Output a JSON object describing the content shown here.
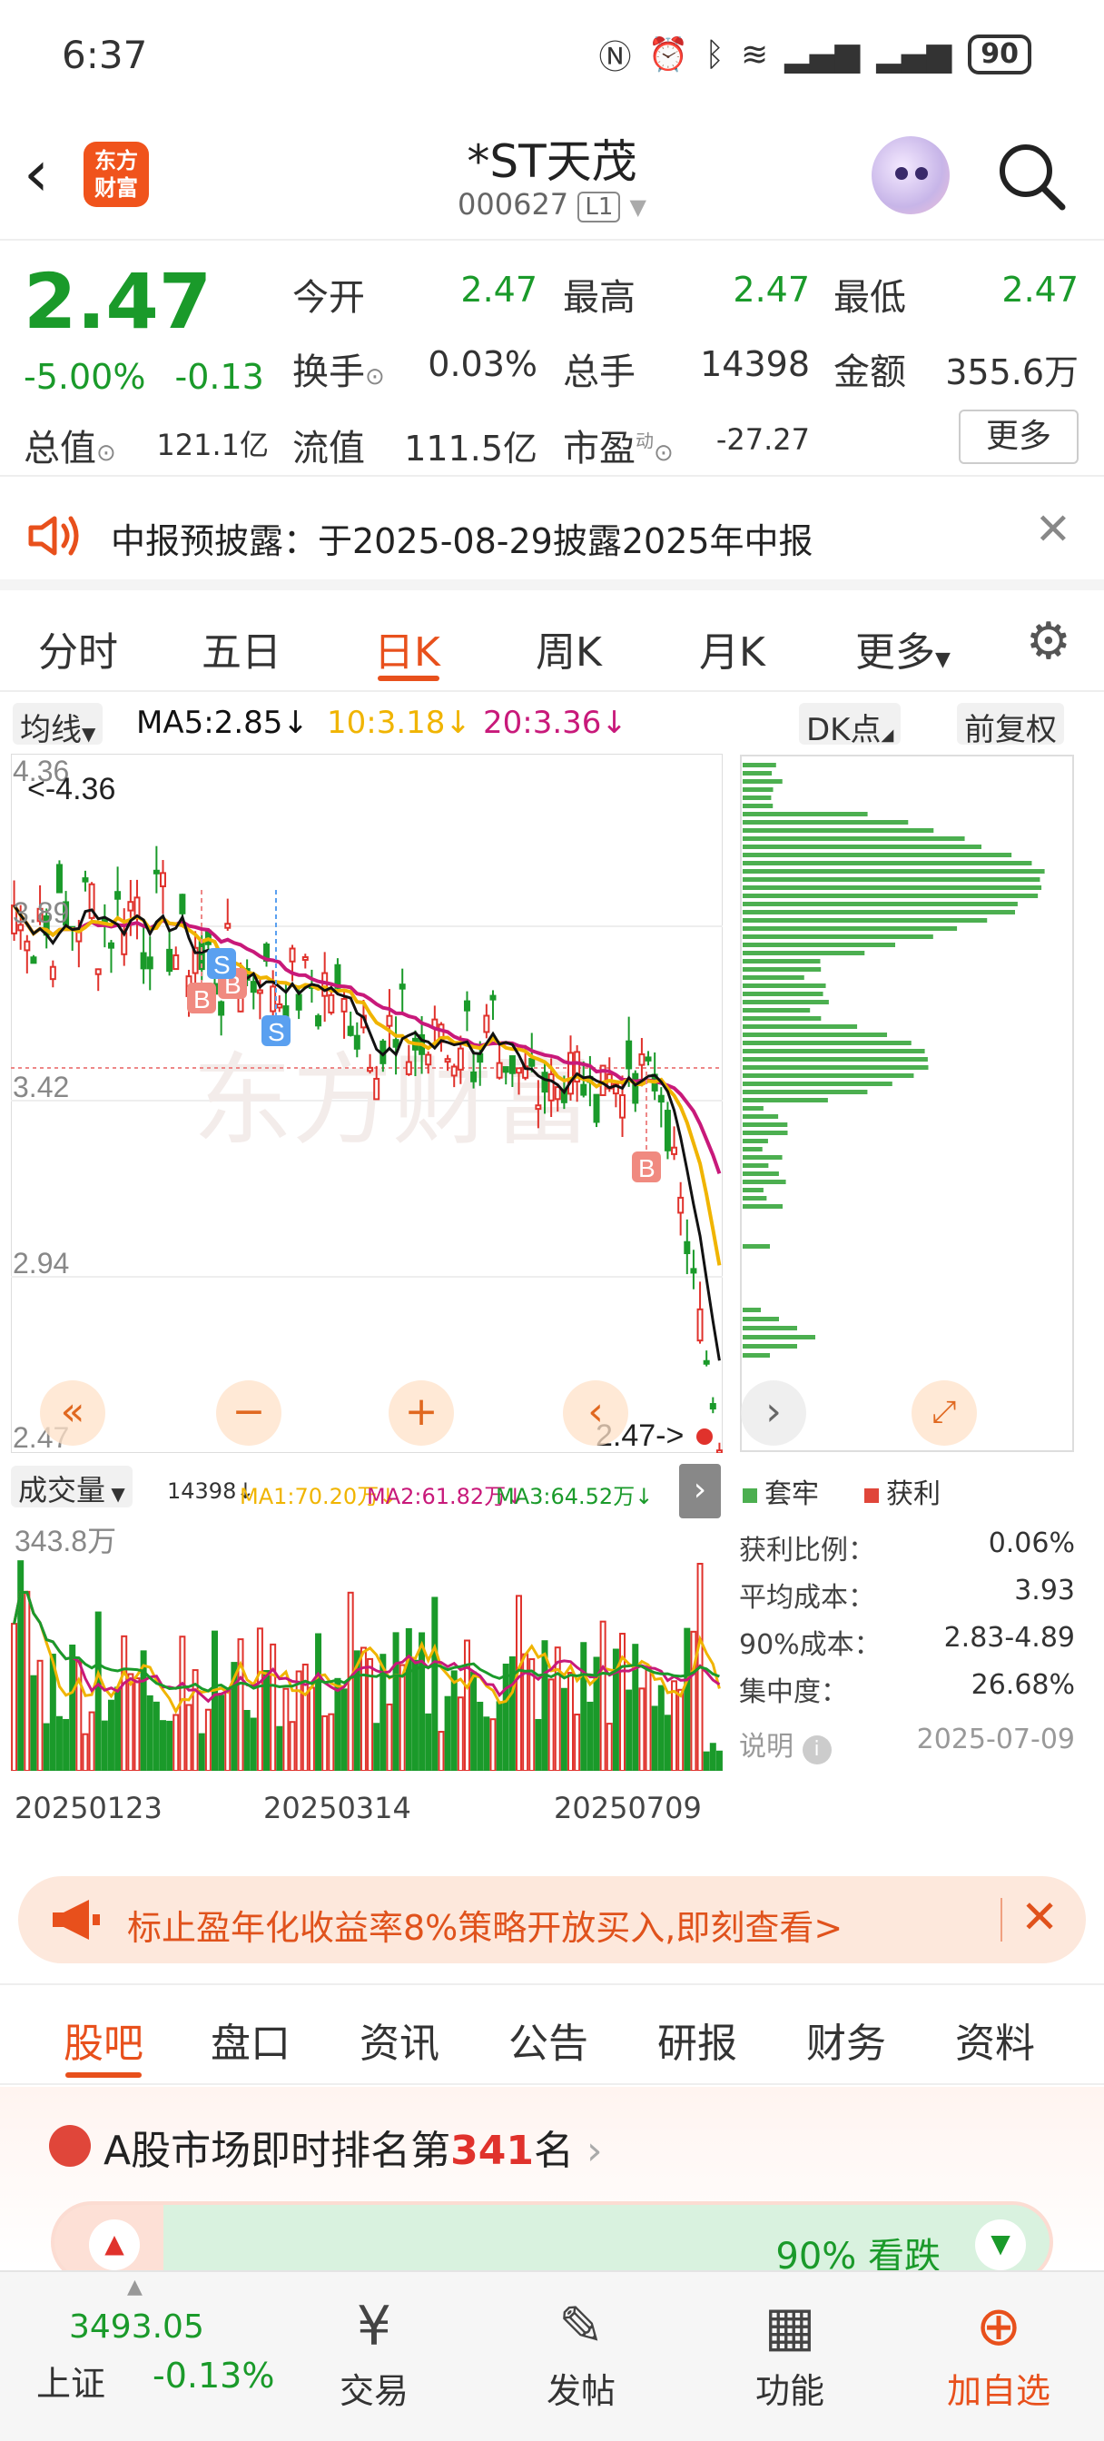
{
  "status_bar": {
    "time": "6:37",
    "battery": "90",
    "icons": [
      "nfc-icon",
      "alarm-icon",
      "bluetooth-icon",
      "wifi-icon",
      "signal-icon",
      "signal-icon"
    ]
  },
  "header": {
    "logo_text": "东方财富",
    "stock_name": "*ST天茂",
    "stock_code": "000627",
    "level": "L1"
  },
  "quote": {
    "price": "2.47",
    "change_pct": "-5.00%",
    "change_amt": "-0.13",
    "fields": [
      {
        "label": "今开",
        "value": "2.47"
      },
      {
        "label": "最高",
        "value": "2.47"
      },
      {
        "label": "最低",
        "value": "2.47"
      },
      {
        "label": "换手",
        "value": "0.03%"
      },
      {
        "label": "总手",
        "value": "14398"
      },
      {
        "label": "金额",
        "value": "355.6万"
      },
      {
        "label": "总值",
        "value": "121.1亿"
      },
      {
        "label": "流值",
        "value": "111.5亿"
      },
      {
        "label": "市盈",
        "value": "-27.27"
      }
    ],
    "pe_sup": "动",
    "more": "更多"
  },
  "notice": {
    "text": "中报预披露：于2025-08-29披露2025年中报"
  },
  "period_tabs": {
    "items": [
      "分时",
      "五日",
      "日K",
      "周K",
      "月K",
      "更多"
    ],
    "active": "日K"
  },
  "ma_bar": {
    "selector": "均线",
    "ma5": "MA5:2.85",
    "ma10": "10:3.18",
    "ma20": "20:3.36",
    "dk": "DK点",
    "adjust": "前复权"
  },
  "kchart_labels": {
    "y_ticks": [
      "4.36",
      "3.89",
      "3.42",
      "2.94",
      "2.47"
    ],
    "max_marker": "<-4.36",
    "last_marker": "2.47->"
  },
  "volume": {
    "selector": "成交量",
    "vol": "14398",
    "ma1": "MA1:70.20万",
    "ma2": "MA2:61.82万",
    "ma3": "MA3:64.52万",
    "max_label": "343.8万",
    "dates": [
      "20250123",
      "20250314",
      "20250709"
    ]
  },
  "chip": {
    "legend_trapped": "套牢",
    "legend_profit": "获利",
    "rows": [
      {
        "label": "获利比例：",
        "value": "0.06%"
      },
      {
        "label": "平均成本：",
        "value": "3.93"
      },
      {
        "label": "90%成本：",
        "value": "2.83-4.89"
      },
      {
        "label": "集中度：",
        "value": "26.68%"
      }
    ],
    "note_label": "说明",
    "date": "2025-07-09"
  },
  "ad": {
    "text": "标止盈年化收益率8%策略开放买入,即刻查看>"
  },
  "content_tabs": {
    "items": [
      "股吧",
      "盘口",
      "资讯",
      "公告",
      "研报",
      "财务",
      "资料"
    ],
    "active": "股吧"
  },
  "rank": {
    "prefix": "A股市场即时排名第",
    "rank": "341",
    "suffix": "名",
    "vote_text": "90% 看跌"
  },
  "bottom": {
    "index_value": "3493.05",
    "index_name": "上证",
    "index_change": "-0.13%",
    "nav": [
      {
        "label": "交易",
        "icon": "yen-exchange-icon"
      },
      {
        "label": "发帖",
        "icon": "edit-icon"
      },
      {
        "label": "功能",
        "icon": "grid-icon"
      },
      {
        "label": "加自选",
        "icon": "add-circle-icon"
      }
    ]
  },
  "colors": {
    "up": "#e0322c",
    "down": "#1a9a2a",
    "accent": "#e8501c",
    "ma5": "#111111",
    "ma10": "#f0b400",
    "ma20": "#c8197a"
  }
}
